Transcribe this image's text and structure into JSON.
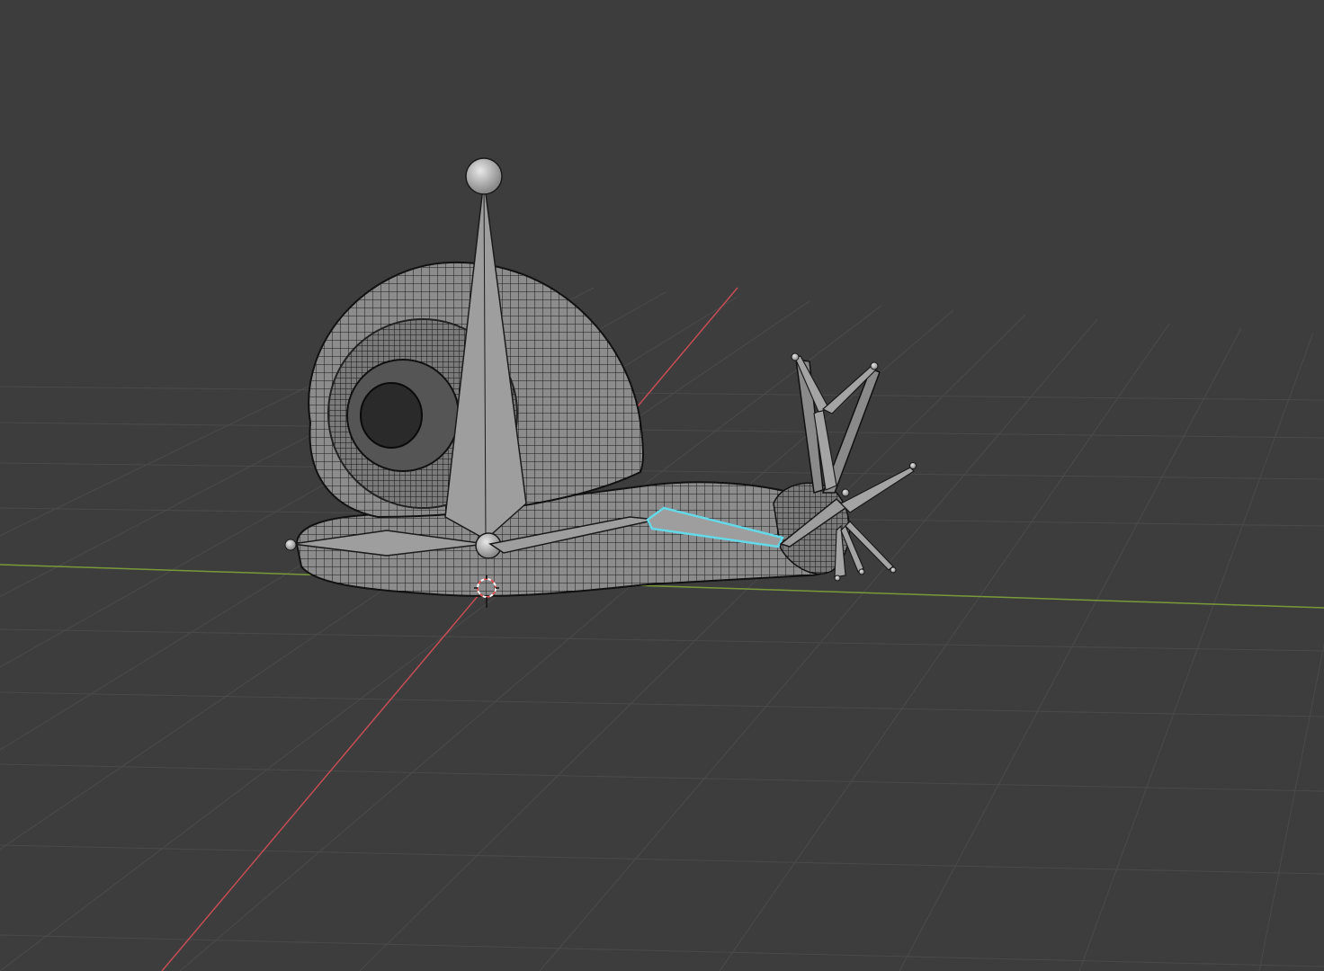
{
  "viewport": {
    "mode": "3d-viewport",
    "background_color": "#3d3d3d",
    "grid_color": "#4a4a4a",
    "x_axis_color": "#c44d55",
    "y_axis_color": "#7a9a3a"
  },
  "scene": {
    "objects": [
      {
        "name": "snail-mesh",
        "type": "mesh",
        "display": "wireframe-overlay",
        "color": "#8a8a8a"
      },
      {
        "name": "snail-armature",
        "type": "armature",
        "display": "octahedral",
        "color": "#9a9a9a"
      }
    ],
    "selected_bone": {
      "name": "body-bone",
      "highlight_color": "#66d9e8"
    },
    "cursor_3d": {
      "icon": "3d-cursor-icon",
      "colors": [
        "#e05050",
        "#ffffff"
      ]
    }
  }
}
